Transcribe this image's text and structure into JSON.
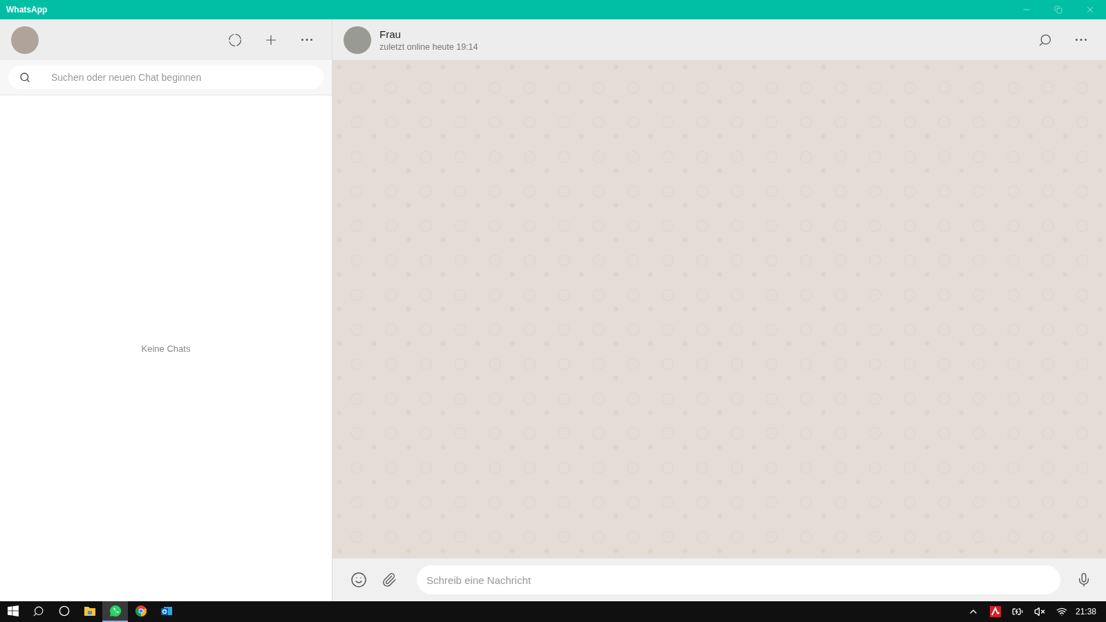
{
  "window": {
    "title": "WhatsApp"
  },
  "sidebar": {
    "search": {
      "placeholder": "Suchen oder neuen Chat beginnen"
    },
    "empty_text": "Keine Chats"
  },
  "chat": {
    "name": "Frau",
    "status": "zuletzt online heute 19:14"
  },
  "composer": {
    "placeholder": "Schreib eine Nachricht"
  },
  "taskbar": {
    "apps": [
      {
        "kind": "explorer",
        "selected": false
      },
      {
        "kind": "whatsapp",
        "selected": true
      },
      {
        "kind": "chrome",
        "selected": false
      },
      {
        "kind": "outlook",
        "selected": false
      }
    ],
    "clock": "21:38"
  }
}
